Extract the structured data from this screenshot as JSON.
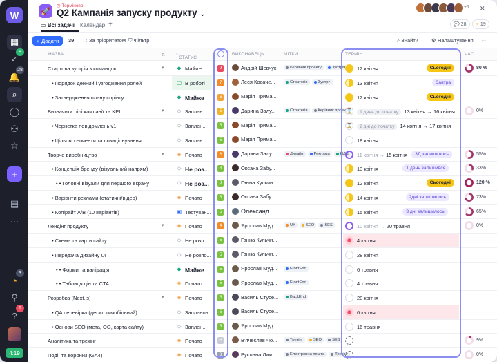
{
  "project": {
    "urgency": "Терміново",
    "title": "Q2 Кампанія запуску продукту"
  },
  "tabs": [
    "Всі задачі",
    "Календар",
    "+"
  ],
  "header": {
    "more_avatars": "+1",
    "comments": "28",
    "bolt": "19"
  },
  "toolbar": {
    "add": "Додати",
    "count": "39",
    "priority": "За пріоритетом",
    "filter": "Фільтр",
    "find": "Знайти",
    "settings": "Налаштування",
    "more": "···"
  },
  "columns": {
    "name": "НАЗВА",
    "status": "СТАТУС",
    "assignee": "ВИКОНАВЕЦЬ",
    "tags": "МІТКИ",
    "due": "ТЕРМІН",
    "time": "ЧАС"
  },
  "rail": {
    "badge1": "8",
    "badge2": "28",
    "badge3": "3",
    "badge4": "1",
    "time": "4:19"
  },
  "colors": {
    "accent": "#2f6bff",
    "highlight": "#8a8ff0",
    "today": "#f5c518",
    "purple": "#7b61ff",
    "overdue": "#f3516b"
  },
  "rows": [
    {
      "name": "Стартова зустріч з командою",
      "lvl": 0,
      "arrow": true,
      "status": "Майже",
      "sic": "◆",
      "sc": "#16a37f",
      "pri": "9",
      "pc": "#e84a5f",
      "who": "Андрій Шевчук",
      "wc": "#6b4a3a",
      "tags": [
        [
          "Керівник проекту",
          "#7a8191"
        ],
        [
          "Зустріч",
          "#2f6bff"
        ]
      ],
      "dico": "sun",
      "due": "12 квітня",
      "badge": "Сьогодні",
      "bt": "y",
      "ring": 80,
      "pct": "80 %"
    },
    {
      "name": "Порядок денний і узгодження ролей",
      "lvl": 1,
      "status": "В роботі",
      "sic": "▢",
      "sc": "#23a86b",
      "pri": "7",
      "pc": "#f28c28",
      "who": "Леся Косаче...",
      "wc": "#a0603a",
      "tags": [
        [
          "Стратегія",
          "#16a37f"
        ],
        [
          "Зустріч",
          "#2f6bff"
        ]
      ],
      "dico": "half",
      "due": "13 квітня",
      "badge": "Завтра",
      "bt": "p",
      "ring": -1,
      "pct": "",
      "stbg": "#eaf6ee"
    },
    {
      "name": "Затвердження плану спрінту",
      "lvl": 1,
      "status": "Майже",
      "sic": "◆",
      "sc": "#16a37f",
      "pri": "6",
      "pc": "#f2a33a",
      "who": "Марія Прима...",
      "wc": "#8a4a2a",
      "tags": [],
      "dico": "sun",
      "due": "12 квітня",
      "badge": "Сьогодні",
      "bt": "y",
      "ring": -1,
      "pct": "",
      "bold": true
    },
    {
      "name": "Визначити цілі кампанії та KPI",
      "lvl": 0,
      "arrow": true,
      "status": "Заплан...",
      "sic": "◇",
      "sc": "#9aa0ad",
      "pri": "5",
      "pc": "#f0b429",
      "who": "Дарина Залу...",
      "wc": "#4a3a6a",
      "tags": [
        [
          "Стратегія",
          "#16a37f"
        ],
        [
          "Керівник проек",
          "#7a8191"
        ]
      ],
      "dico": "hour",
      "due": "1 день до початку  13 квітня → 16 квітня",
      "badge": "",
      "bt": "",
      "ring": 0,
      "pct": "0%"
    },
    {
      "name": "Чернетка повідомлень v1",
      "lvl": 1,
      "status": "Заплан...",
      "sic": "◇",
      "sc": "#9aa0ad",
      "pri": "5",
      "pc": "#7cc242",
      "who": "Марія Прима...",
      "wc": "#8a4a2a",
      "tags": [],
      "dico": "hour",
      "due": "2 дні до початку  14 квітня → 17 квітня",
      "badge": "",
      "bt": "",
      "ring": -1,
      "pct": ""
    },
    {
      "name": "Цільові сегменти та позиціонування",
      "lvl": 1,
      "status": "Заплан...",
      "sic": "◇",
      "sc": "#9aa0ad",
      "pri": "5",
      "pc": "#7cc242",
      "who": "Марія Прима...",
      "wc": "#8a4a2a",
      "tags": [],
      "dico": "empty",
      "due": "18 квітня",
      "badge": "",
      "bt": "",
      "ring": -1,
      "pct": ""
    },
    {
      "name": "Творче виробництво",
      "lvl": 0,
      "arrow": true,
      "status": "Почато",
      "sic": "◈",
      "sc": "#f28c28",
      "pri": "8",
      "pc": "#f28c28",
      "who": "Дарина Залу...",
      "wc": "#4a3a6a",
      "tags": [
        [
          "Дизайн",
          "#e84a5f"
        ],
        [
          "Реклама",
          "#2f6bff"
        ],
        [
          "НДД",
          "#16a37f"
        ]
      ],
      "dico": "ring",
      "due": "11 квітня → 15 квітня",
      "badge": "3Д залишилось",
      "bt": "p",
      "ring": 55,
      "pct": "55%"
    },
    {
      "name": "Концепція бренду (візуальний напрям)",
      "lvl": 1,
      "status": "Не роз...",
      "sic": "◇",
      "sc": "#9aa0ad",
      "pri": "8",
      "pc": "#7cc242",
      "who": "Оксана Забу...",
      "wc": "#3a2a2a",
      "tags": [],
      "dico": "half",
      "due": "13 квітня",
      "badge": "1 день залишився",
      "bt": "p",
      "ring": 33,
      "pct": "33%",
      "bold": true
    },
    {
      "name": "Головні візуали для першого екрану",
      "lvl": 2,
      "status": "Не роз...",
      "sic": "◇",
      "sc": "#9aa0ad",
      "pri": "8",
      "pc": "#7cc242",
      "who": "Ганна Кульчи...",
      "wc": "#5a5a6a",
      "tags": [],
      "dico": "sun",
      "due": "12 квітня",
      "badge": "Сьогодні",
      "bt": "y",
      "ring": 120,
      "pct": "120 %",
      "bold": true
    },
    {
      "name": "Варіанти реклами (статичні/відео)",
      "lvl": 1,
      "status": "Почато",
      "sic": "◈",
      "sc": "#f28c28",
      "pri": "5",
      "pc": "#7cc242",
      "who": "Оксана Забу...",
      "wc": "#3a2a2a",
      "tags": [],
      "dico": "half",
      "due": "14 квітня",
      "badge": "2дні залишилось",
      "bt": "p",
      "ring": 73,
      "pct": "73%"
    },
    {
      "name": "Копірайт A/B (10 варіантів)",
      "lvl": 1,
      "status": "Тестуван...",
      "sic": "▣",
      "sc": "#2f6bff",
      "pri": "5",
      "pc": "#7cc242",
      "who": "Олександ...",
      "wc": "#5a6a7a",
      "tags": [],
      "dico": "half",
      "due": "15 квітня",
      "badge": "3 дні залишилось",
      "bt": "p",
      "ring": 65,
      "pct": "65%",
      "wbig": true
    },
    {
      "name": "Лендінг продукту",
      "lvl": 0,
      "arrow": true,
      "status": "Почато",
      "sic": "◈",
      "sc": "#f28c28",
      "pri": "4",
      "pc": "#f28c28",
      "who": "Ярослав Муд...",
      "wc": "#6a5a4a",
      "tags": [
        [
          "UX",
          "#f28c28"
        ],
        [
          "SEO",
          "#f0b429"
        ],
        [
          "SES",
          "#7a8191"
        ]
      ],
      "dico": "ring",
      "due": "10 квітня → 20 травня",
      "badge": "",
      "bt": "",
      "ring": 0,
      "pct": "0%"
    },
    {
      "name": "Схема та карти сайту",
      "lvl": 1,
      "status": "Не розп...",
      "sic": "◇",
      "sc": "#9aa0ad",
      "pri": "5",
      "pc": "#7cc242",
      "who": "Ганна Кульчи...",
      "wc": "#5a5a6a",
      "tags": [],
      "dico": "red",
      "due": "4 квітня",
      "badge": "",
      "bt": "",
      "ring": -1,
      "pct": "",
      "over": true
    },
    {
      "name": "Передача дизайну UI",
      "lvl": 1,
      "status": "Не розпо...",
      "sic": "◇",
      "sc": "#9aa0ad",
      "pri": "5",
      "pc": "#7cc242",
      "who": "Ганна Кульчи...",
      "wc": "#5a5a6a",
      "tags": [],
      "dico": "empty",
      "due": "28 квітня",
      "badge": "",
      "bt": "",
      "ring": -1,
      "pct": ""
    },
    {
      "name": "Форми та валідація",
      "lvl": 2,
      "status": "Майже",
      "sic": "◆",
      "sc": "#16a37f",
      "pri": "5",
      "pc": "#7cc242",
      "who": "Ярослав Муд...",
      "wc": "#6a5a4a",
      "tags": [
        [
          "FrontEnd",
          "#2f6bff"
        ]
      ],
      "dico": "empty",
      "due": "6 травня",
      "badge": "",
      "bt": "",
      "ring": -1,
      "pct": "",
      "bold": true
    },
    {
      "name": "Таблиця цін та CTA",
      "lvl": 2,
      "status": "Почато",
      "sic": "◈",
      "sc": "#f28c28",
      "pri": "5",
      "pc": "#7cc242",
      "who": "Ярослав Муд...",
      "wc": "#6a5a4a",
      "tags": [
        [
          "FrontEnd",
          "#2f6bff"
        ]
      ],
      "dico": "empty",
      "due": "4 травня",
      "badge": "",
      "bt": "",
      "ring": -1,
      "pct": ""
    },
    {
      "name": "Розробка (Next.js)",
      "lvl": 0,
      "arrow": true,
      "status": "Почато",
      "sic": "◈",
      "sc": "#f28c28",
      "pri": "5",
      "pc": "#7cc242",
      "who": "Василь Стусе...",
      "wc": "#4a4a5a",
      "tags": [
        [
          "BackEnd",
          "#16a37f"
        ]
      ],
      "dico": "empty",
      "due": "28 квітня",
      "badge": "",
      "bt": "",
      "ring": -1,
      "pct": ""
    },
    {
      "name": "QA перевірка (десктоп/мобільний)",
      "lvl": 1,
      "status": "Запланов...",
      "sic": "◇",
      "sc": "#9aa0ad",
      "pri": "5",
      "pc": "#7cc242",
      "who": "Василь Стусе...",
      "wc": "#4a4a5a",
      "tags": [],
      "dico": "red",
      "due": "6 квітня",
      "badge": "",
      "bt": "",
      "ring": -1,
      "pct": "",
      "over": true
    },
    {
      "name": "Основи SEO (мета, OG, карта сайту)",
      "lvl": 1,
      "status": "Заплан...",
      "sic": "◇",
      "sc": "#9aa0ad",
      "pri": "5",
      "pc": "#7cc242",
      "who": "Ярослав Муд...",
      "wc": "#6a5a4a",
      "tags": [],
      "dico": "empty",
      "due": "16 травня",
      "badge": "",
      "bt": "",
      "ring": -1,
      "pct": ""
    },
    {
      "name": "Аналітика та трекінг",
      "lvl": 0,
      "status": "Почато",
      "sic": "◈",
      "sc": "#f28c28",
      "pri": "H",
      "pc": "#c8ccd6",
      "who": "В'ячеслав Чо...",
      "wc": "#7a5a4a",
      "tags": [
        [
          "Трекінг",
          "#7a8191"
        ],
        [
          "SEO",
          "#f0b429"
        ],
        [
          "SES",
          "#7a8191"
        ]
      ],
      "dico": "dash",
      "due": "",
      "badge": "",
      "bt": "",
      "ring": 9,
      "pct": "9%"
    },
    {
      "name": "Події та воронки (GA4)",
      "lvl": 0,
      "status": "Почато",
      "sic": "◈",
      "sc": "#f28c28",
      "pri": "3",
      "pc": "#9aa0ad",
      "who": "Руслана Лиж...",
      "wc": "#5a3a5a",
      "tags": [
        [
          "Електронна пошта",
          "#7a8191"
        ],
        [
          "Трекінг",
          "#7a8191"
        ]
      ],
      "dico": "dash",
      "due": "",
      "badge": "",
      "bt": "",
      "ring": 0,
      "pct": "0%"
    }
  ]
}
